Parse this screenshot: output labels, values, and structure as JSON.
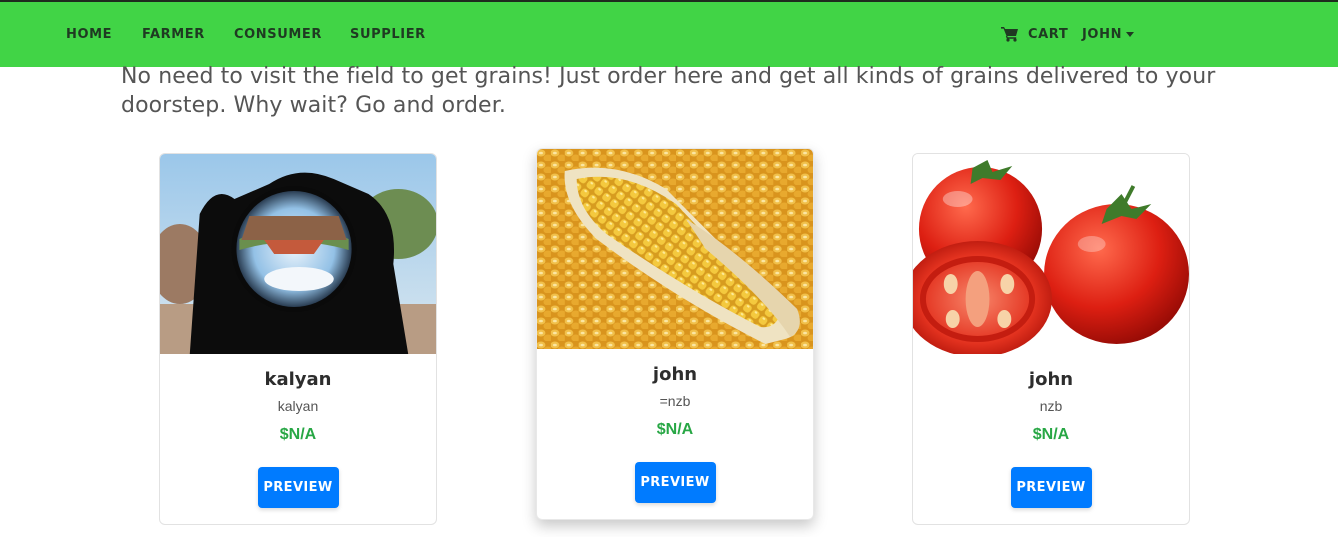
{
  "nav": {
    "links": [
      "HOME",
      "FARMER",
      "CONSUMER",
      "SUPPLIER"
    ],
    "cart_label": "CART",
    "user_label": "JOHN",
    "bar_color": "#41d446",
    "cart_icon": "shopping-cart-icon"
  },
  "intro_text": "No need to visit the field to get grains! Just order here and get all kinds of grains delivered to your doorstep. Why wait? Go and order.",
  "products": [
    {
      "title": "kalyan",
      "subtitle": "kalyan",
      "price": "$N/A",
      "button_label": "PREVIEW",
      "image": "lens-ball-landscape-photo"
    },
    {
      "title": "john",
      "subtitle": "=nzb",
      "price": "$N/A",
      "button_label": "PREVIEW",
      "image": "corn-cob-photo"
    },
    {
      "title": "john",
      "subtitle": "nzb",
      "price": "$N/A",
      "button_label": "PREVIEW",
      "image": "tomatoes-photo"
    }
  ],
  "colors": {
    "price": "#28a745",
    "button": "#007bff"
  }
}
